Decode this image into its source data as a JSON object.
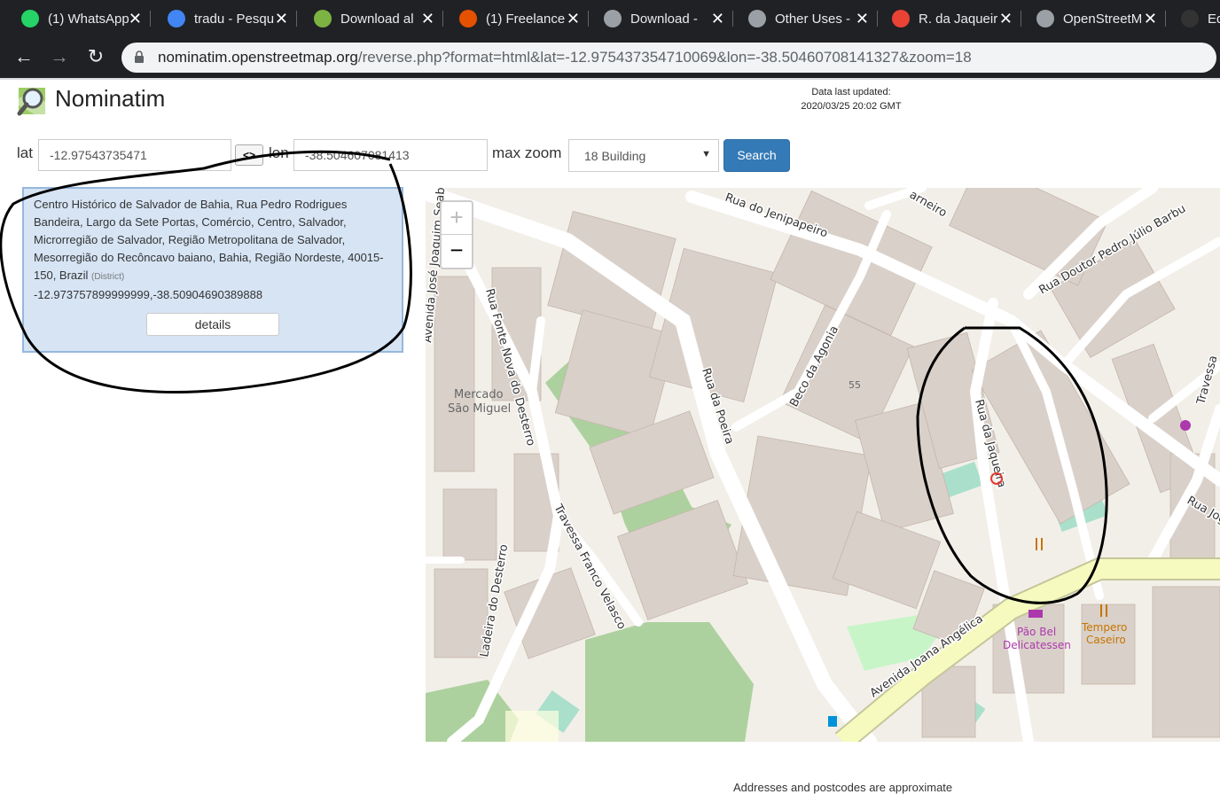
{
  "browser": {
    "tabs": [
      {
        "label": "(1) WhatsApp",
        "icon": "whatsapp-icon",
        "color": "#25d366"
      },
      {
        "label": "tradu - Pesqu",
        "icon": "google-icon",
        "color": "#4285f4"
      },
      {
        "label": "Download al",
        "icon": "map-icon",
        "color": "#7cb342"
      },
      {
        "label": "(1) Freelance",
        "icon": "freelancer-icon",
        "color": "#e65100"
      },
      {
        "label": "Download -",
        "icon": "globe-icon",
        "color": "#9aa0a6"
      },
      {
        "label": "Other Uses -",
        "icon": "globe-icon",
        "color": "#9aa0a6"
      },
      {
        "label": "R. da Jaqueir",
        "icon": "maps-pin-icon",
        "color": "#ea4335"
      },
      {
        "label": "OpenStreetM",
        "icon": "globe-icon",
        "color": "#9aa0a6"
      },
      {
        "label": "Ed",
        "icon": "github-icon",
        "color": "#333333"
      }
    ],
    "url_host": "nominatim.openstreetmap.org",
    "url_rest": "/reverse.php?format=html&lat=-12.975437354710069&lon=-38.50460708141327&zoom=18"
  },
  "header": {
    "brand": "Nominatim",
    "updated_label": "Data last updated:",
    "updated_value": "2020/03/25 20:02 GMT"
  },
  "search": {
    "lat_label": "lat",
    "lat_value": "-12.97543735471",
    "swap_label": "<>",
    "lon_label": "lon",
    "lon_value": "-38.504607081413",
    "maxzoom_label": "max zoom",
    "maxzoom_value": "18 Building",
    "button_label": "Search"
  },
  "result": {
    "address": "Centro Histórico de Salvador de Bahia, Rua Pedro Rodrigues Bandeira, Largo da Sete Portas, Comércio, Centro, Salvador, Microrregião de Salvador, Região Metropolitana de Salvador, Mesorregião do Recôncavo baiano, Bahia, Região Nordeste, 40015-150, Brazil",
    "type": "(District)",
    "coords": "-12.973757899999999,-38.50904690389888",
    "details_label": "details"
  },
  "map": {
    "zoom_in": "+",
    "zoom_out": "−",
    "labels": {
      "rua_jenipapeiro": "Rua do Jenipapeiro",
      "carneiro": "arneiro",
      "rua_pedro_julio": "Rua Doutor Pedro Júlio Barbu",
      "avenida_jose": "Avenida José Joaquim Seab",
      "rua_fonte_nova": "Rua Fonte Nova do Desterro",
      "mercado_1": "Mercado",
      "mercado_2": "São Miguel",
      "rua_poeira": "Rua da Poeira",
      "beco_agonia": "Beco da Agonia",
      "house_number": "55",
      "rua_jaqueira": "Rua da Jaqueira",
      "travessa_right": "Travessa",
      "rua_jog": "Rua Jog",
      "travessa_franco": "Travessa Franco Velasco",
      "ladeira": "Ladeira do Desterro",
      "avenida_joana": "Avenida Joana Angélica",
      "pao_1": "Pão Bel",
      "pao_2": "Delicatessen",
      "tempero_1": "Tempero",
      "tempero_2": "Caseiro"
    },
    "colors": {
      "land": "#f2efe9",
      "building": "#d9d0c9",
      "park": "#add19e",
      "primary": "#f7fabf",
      "pitch": "#aae0cb",
      "poi_purple": "#ac39ac",
      "poi_orange": "#c77400"
    }
  },
  "footer": {
    "note": "Addresses and postcodes are approximate"
  }
}
